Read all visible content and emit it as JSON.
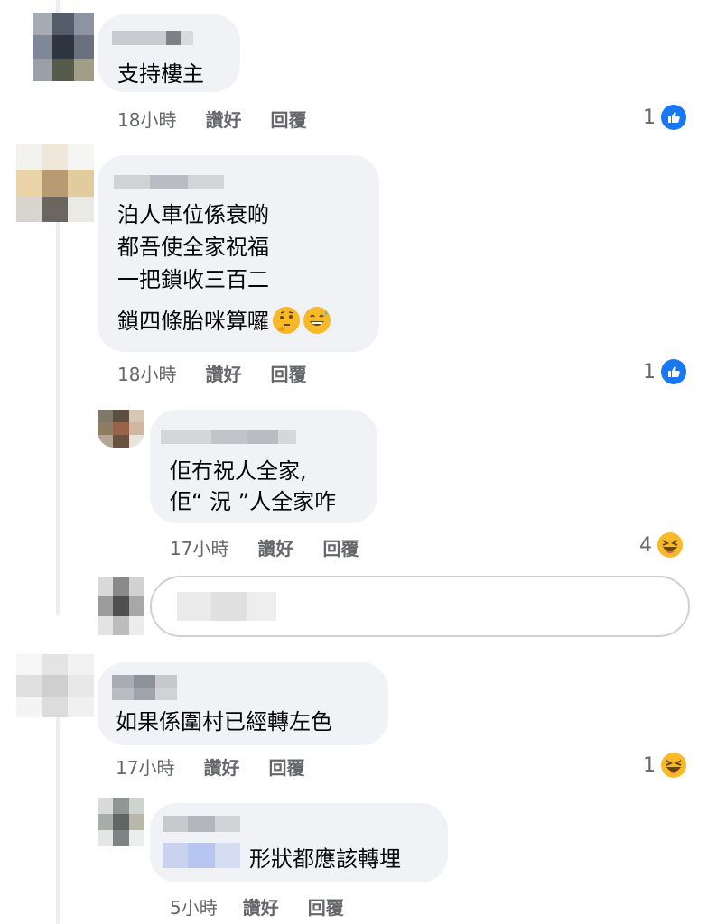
{
  "comments": [
    {
      "text_lines": [
        "支持樓主"
      ],
      "time": "18小時",
      "like_label": "讚好",
      "reply_label": "回覆",
      "reaction_count": "1",
      "reaction_type": "like-icon"
    },
    {
      "text_lines": [
        "泊人車位係衰啲",
        "都吾使全家祝福",
        "一把鎖收三百二",
        "鎖四條胎咪算囉"
      ],
      "time": "18小時",
      "like_label": "讚好",
      "reply_label": "回覆",
      "reaction_count": "1",
      "reaction_type": "like-icon",
      "inline_emojis": [
        "thinking-face-icon",
        "grinning-sweat-icon"
      ]
    },
    {
      "text_lines": [
        "佢冇祝人全家,",
        "佢“ 況 ”人全家咋"
      ],
      "time": "17小時",
      "like_label": "讚好",
      "reply_label": "回覆",
      "reaction_count": "4",
      "reaction_type": "haha-icon"
    },
    {
      "text_lines": [
        "如果係圍村已經轉左色"
      ],
      "time": "17小時",
      "like_label": "讚好",
      "reply_label": "回覆",
      "reaction_count": "1",
      "reaction_type": "haha-icon"
    },
    {
      "text_lines": [
        "形狀都應該轉埋"
      ],
      "time": "5小時",
      "like_label": "讚好",
      "reply_label": "回覆"
    }
  ],
  "colors": {
    "bubble": "#f0f2f5",
    "meta_text": "#65676b",
    "like_blue": "#1877f2",
    "haha_yellow": "#f7b928",
    "thread_line": "#eceef1"
  }
}
